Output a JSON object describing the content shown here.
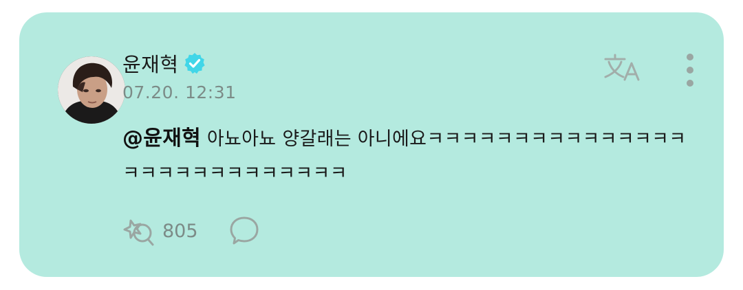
{
  "post": {
    "author": {
      "name": "윤재혁",
      "verified": true,
      "avatar": "profile-photo"
    },
    "timestamp": "07.20. 12:31",
    "mention": "@윤재혁",
    "text": " 아뇨아뇨 양갈래는 아니에요ㅋㅋㅋㅋㅋㅋㅋㅋㅋㅋㅋㅋㅋㅋㅋㅋㅋㅋㅋㅋㅋㅋㅋㅋㅋㅋㅋㅋ",
    "likes": "805",
    "icons": {
      "translate": "translate-icon",
      "more": "more-vertical-icon",
      "like": "like-icon",
      "comment": "comment-icon",
      "verified": "verified-badge-icon"
    }
  },
  "colors": {
    "card_background": "#b4eadf",
    "verified_badge": "#41d6e8",
    "muted_text": "#7c8b87",
    "icon_gray": "#9aa6a2"
  }
}
